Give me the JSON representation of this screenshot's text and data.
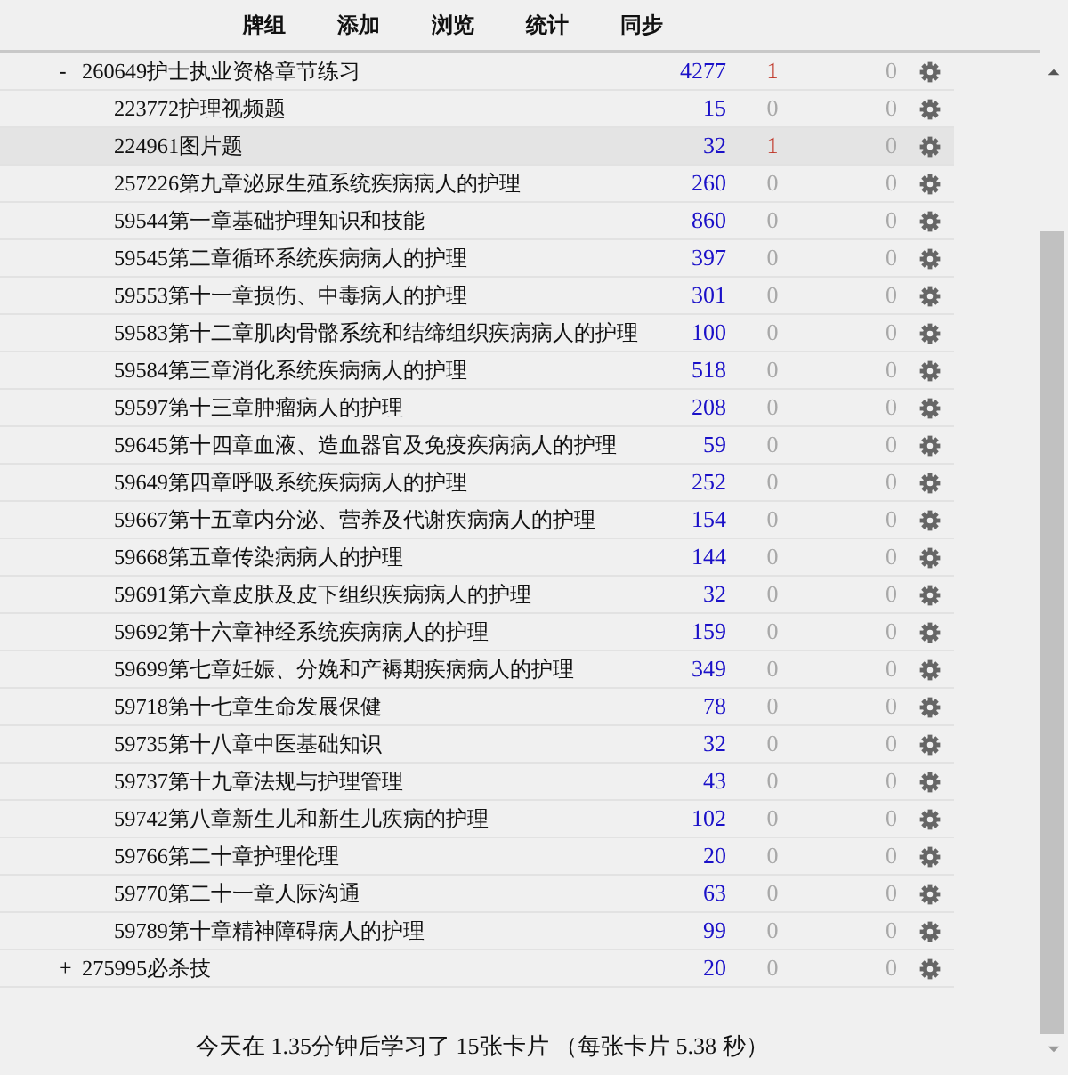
{
  "toolbar": [
    {
      "label": "牌组"
    },
    {
      "label": "添加"
    },
    {
      "label": "浏览"
    },
    {
      "label": "统计"
    },
    {
      "label": "同步"
    }
  ],
  "decks": [
    {
      "name": "260649护士执业资格章节练习",
      "new": "4277",
      "learn": "1",
      "due": "0",
      "learn_active": true,
      "due_active": false,
      "selected": false,
      "expanded": true,
      "children": [
        {
          "name": "223772护理视频题",
          "new": "15",
          "learn": "0",
          "due": "0",
          "learn_active": false,
          "due_active": false,
          "selected": false
        },
        {
          "name": "224961图片题",
          "new": "32",
          "learn": "1",
          "due": "0",
          "learn_active": true,
          "due_active": false,
          "selected": true
        },
        {
          "name": "257226第九章泌尿生殖系统疾病病人的护理",
          "new": "260",
          "learn": "0",
          "due": "0",
          "learn_active": false,
          "due_active": false,
          "selected": false
        },
        {
          "name": "59544第一章基础护理知识和技能",
          "new": "860",
          "learn": "0",
          "due": "0",
          "learn_active": false,
          "due_active": false,
          "selected": false
        },
        {
          "name": "59545第二章循环系统疾病病人的护理",
          "new": "397",
          "learn": "0",
          "due": "0",
          "learn_active": false,
          "due_active": false,
          "selected": false
        },
        {
          "name": "59553第十一章损伤、中毒病人的护理",
          "new": "301",
          "learn": "0",
          "due": "0",
          "learn_active": false,
          "due_active": false,
          "selected": false
        },
        {
          "name": "59583第十二章肌肉骨骼系统和结缔组织疾病病人的护理",
          "new": "100",
          "learn": "0",
          "due": "0",
          "learn_active": false,
          "due_active": false,
          "selected": false
        },
        {
          "name": "59584第三章消化系统疾病病人的护理",
          "new": "518",
          "learn": "0",
          "due": "0",
          "learn_active": false,
          "due_active": false,
          "selected": false
        },
        {
          "name": "59597第十三章肿瘤病人的护理",
          "new": "208",
          "learn": "0",
          "due": "0",
          "learn_active": false,
          "due_active": false,
          "selected": false
        },
        {
          "name": "59645第十四章血液、造血器官及免疫疾病病人的护理",
          "new": "59",
          "learn": "0",
          "due": "0",
          "learn_active": false,
          "due_active": false,
          "selected": false
        },
        {
          "name": "59649第四章呼吸系统疾病病人的护理",
          "new": "252",
          "learn": "0",
          "due": "0",
          "learn_active": false,
          "due_active": false,
          "selected": false
        },
        {
          "name": "59667第十五章内分泌、营养及代谢疾病病人的护理",
          "new": "154",
          "learn": "0",
          "due": "0",
          "learn_active": false,
          "due_active": false,
          "selected": false
        },
        {
          "name": "59668第五章传染病病人的护理",
          "new": "144",
          "learn": "0",
          "due": "0",
          "learn_active": false,
          "due_active": false,
          "selected": false
        },
        {
          "name": "59691第六章皮肤及皮下组织疾病病人的护理",
          "new": "32",
          "learn": "0",
          "due": "0",
          "learn_active": false,
          "due_active": false,
          "selected": false
        },
        {
          "name": "59692第十六章神经系统疾病病人的护理",
          "new": "159",
          "learn": "0",
          "due": "0",
          "learn_active": false,
          "due_active": false,
          "selected": false
        },
        {
          "name": "59699第七章妊娠、分娩和产褥期疾病病人的护理",
          "new": "349",
          "learn": "0",
          "due": "0",
          "learn_active": false,
          "due_active": false,
          "selected": false
        },
        {
          "name": "59718第十七章生命发展保健",
          "new": "78",
          "learn": "0",
          "due": "0",
          "learn_active": false,
          "due_active": false,
          "selected": false
        },
        {
          "name": "59735第十八章中医基础知识",
          "new": "32",
          "learn": "0",
          "due": "0",
          "learn_active": false,
          "due_active": false,
          "selected": false
        },
        {
          "name": "59737第十九章法规与护理管理",
          "new": "43",
          "learn": "0",
          "due": "0",
          "learn_active": false,
          "due_active": false,
          "selected": false
        },
        {
          "name": "59742第八章新生儿和新生儿疾病的护理",
          "new": "102",
          "learn": "0",
          "due": "0",
          "learn_active": false,
          "due_active": false,
          "selected": false
        },
        {
          "name": "59766第二十章护理伦理",
          "new": "20",
          "learn": "0",
          "due": "0",
          "learn_active": false,
          "due_active": false,
          "selected": false
        },
        {
          "name": "59770第二十一章人际沟通",
          "new": "63",
          "learn": "0",
          "due": "0",
          "learn_active": false,
          "due_active": false,
          "selected": false
        },
        {
          "name": "59789第十章精神障碍病人的护理",
          "new": "99",
          "learn": "0",
          "due": "0",
          "learn_active": false,
          "due_active": false,
          "selected": false
        }
      ]
    },
    {
      "name": "275995必杀技",
      "new": "20",
      "learn": "0",
      "due": "0",
      "learn_active": false,
      "due_active": false,
      "selected": false,
      "expanded": false,
      "collapse_sign": "+"
    }
  ],
  "expand_sign": "-",
  "footer": "今天在 1.35分钟后学习了 15张卡片 （每张卡片 5.38 秒）"
}
